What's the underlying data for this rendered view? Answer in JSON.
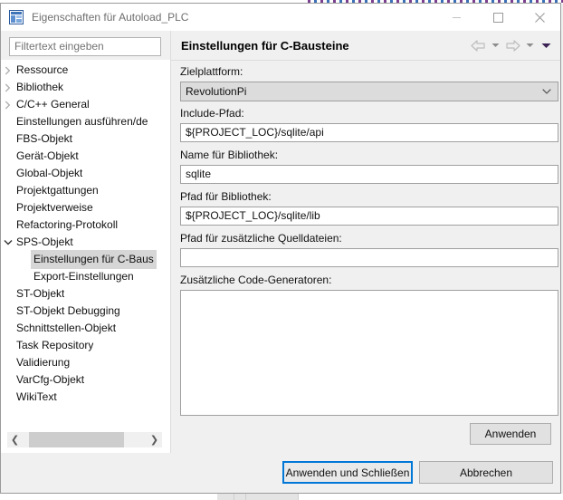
{
  "window": {
    "title": "Eigenschaften für Autoload_PLC",
    "icon": "properties-window-icon",
    "controls": {
      "minimize": "minimize-icon",
      "maximize": "maximize-icon",
      "close": "close-icon"
    }
  },
  "sidebar": {
    "filter": {
      "value": "",
      "placeholder": "Filtertext eingeben"
    },
    "items": [
      {
        "label": "Ressource",
        "level": 0,
        "twisty": "collapsed",
        "selected": false
      },
      {
        "label": "Bibliothek",
        "level": 0,
        "twisty": "collapsed",
        "selected": false
      },
      {
        "label": "C/C++ General",
        "level": 0,
        "twisty": "collapsed",
        "selected": false
      },
      {
        "label": "Einstellungen ausführen/de",
        "level": 0,
        "twisty": "none",
        "selected": false
      },
      {
        "label": "FBS-Objekt",
        "level": 0,
        "twisty": "none",
        "selected": false
      },
      {
        "label": "Gerät-Objekt",
        "level": 0,
        "twisty": "none",
        "selected": false
      },
      {
        "label": "Global-Objekt",
        "level": 0,
        "twisty": "none",
        "selected": false
      },
      {
        "label": "Projektgattungen",
        "level": 0,
        "twisty": "none",
        "selected": false
      },
      {
        "label": "Projektverweise",
        "level": 0,
        "twisty": "none",
        "selected": false
      },
      {
        "label": "Refactoring-Protokoll",
        "level": 0,
        "twisty": "none",
        "selected": false
      },
      {
        "label": "SPS-Objekt",
        "level": 0,
        "twisty": "expanded",
        "selected": false
      },
      {
        "label": "Einstellungen für C-Baus",
        "level": 1,
        "twisty": "none",
        "selected": true
      },
      {
        "label": "Export-Einstellungen",
        "level": 1,
        "twisty": "none",
        "selected": false
      },
      {
        "label": "ST-Objekt",
        "level": 0,
        "twisty": "none",
        "selected": false
      },
      {
        "label": "ST-Objekt Debugging",
        "level": 0,
        "twisty": "none",
        "selected": false
      },
      {
        "label": "Schnittstellen-Objekt",
        "level": 0,
        "twisty": "none",
        "selected": false
      },
      {
        "label": "Task Repository",
        "level": 0,
        "twisty": "none",
        "selected": false
      },
      {
        "label": "Validierung",
        "level": 0,
        "twisty": "none",
        "selected": false
      },
      {
        "label": "VarCfg-Objekt",
        "level": 0,
        "twisty": "none",
        "selected": false
      },
      {
        "label": "WikiText",
        "level": 0,
        "twisty": "none",
        "selected": false
      }
    ],
    "scrollbar": {
      "left_arrow": "scroll-left-icon",
      "right_arrow": "scroll-right-icon"
    }
  },
  "page": {
    "title": "Einstellungen für C-Bausteine",
    "nav": {
      "back": "back-arrow-icon",
      "back_menu": "back-dropdown-icon",
      "forward": "forward-arrow-icon",
      "forward_menu": "forward-dropdown-icon",
      "view_menu": "view-menu-icon"
    },
    "fields": [
      {
        "label": "Zielplattform:",
        "type": "combo",
        "value": "RevolutionPi",
        "name": "target-platform"
      },
      {
        "label": "Include-Pfad:",
        "type": "text",
        "value": "${PROJECT_LOC}/sqlite/api",
        "name": "include-path"
      },
      {
        "label": "Name für Bibliothek:",
        "type": "text",
        "value": "sqlite",
        "name": "library-name"
      },
      {
        "label": "Pfad für Bibliothek:",
        "type": "text",
        "value": "${PROJECT_LOC}/sqlite/lib",
        "name": "library-path"
      },
      {
        "label": "Pfad für zusätzliche Quelldateien:",
        "type": "text",
        "value": "",
        "name": "additional-sources-path"
      },
      {
        "label": "Zusätzliche Code-Generatoren:",
        "type": "textarea",
        "value": "",
        "name": "additional-code-generators"
      }
    ],
    "apply_label": "Anwenden"
  },
  "footer": {
    "primary_label": "Anwenden und Schließen",
    "cancel_label": "Abbrechen"
  },
  "colors": {
    "accent": "#0078d7",
    "titlebar_bg": "#ffffff",
    "dialog_bg": "#f0f0f0",
    "selection": "#d6d6d6"
  }
}
